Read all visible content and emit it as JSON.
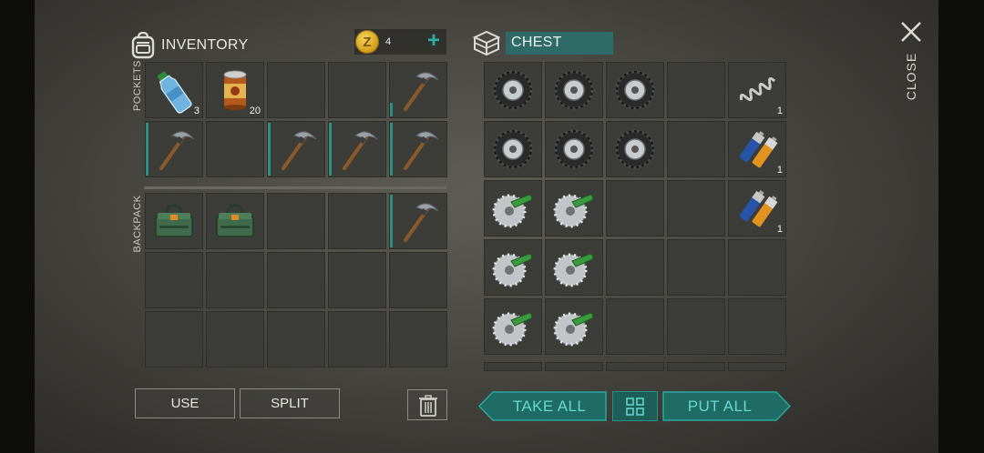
{
  "inventory": {
    "title": "INVENTORY",
    "coins": "4",
    "pockets_label": "POCKETS",
    "backpack_label": "BACKPACK",
    "pockets": [
      {
        "item": "water-bottle",
        "qty": "3"
      },
      {
        "item": "canned-food",
        "qty": "20"
      },
      {
        "item": "empty"
      },
      {
        "item": "empty"
      },
      {
        "item": "pickaxe",
        "durability": 0.25
      },
      {
        "item": "pickaxe",
        "durability": 1.0
      },
      {
        "item": "empty"
      },
      {
        "item": "pickaxe",
        "durability": 1.0
      },
      {
        "item": "pickaxe",
        "durability": 1.0
      },
      {
        "item": "pickaxe",
        "durability": 1.0
      }
    ],
    "backpack": [
      {
        "item": "toolbox"
      },
      {
        "item": "toolbox"
      },
      {
        "item": "empty"
      },
      {
        "item": "empty"
      },
      {
        "item": "pickaxe",
        "durability": 1.0
      },
      {
        "item": "empty"
      },
      {
        "item": "empty"
      },
      {
        "item": "empty"
      },
      {
        "item": "empty"
      },
      {
        "item": "empty"
      },
      {
        "item": "empty"
      },
      {
        "item": "empty"
      },
      {
        "item": "empty"
      },
      {
        "item": "empty"
      },
      {
        "item": "empty"
      }
    ]
  },
  "chest": {
    "title": "CHEST",
    "slots": [
      {
        "item": "tire"
      },
      {
        "item": "tire"
      },
      {
        "item": "tire"
      },
      {
        "item": "empty"
      },
      {
        "item": "spring",
        "qty": "1"
      },
      {
        "item": "tire"
      },
      {
        "item": "tire"
      },
      {
        "item": "tire"
      },
      {
        "item": "empty"
      },
      {
        "item": "batteries",
        "qty": "1"
      },
      {
        "item": "saw-blade"
      },
      {
        "item": "saw-blade"
      },
      {
        "item": "empty"
      },
      {
        "item": "empty"
      },
      {
        "item": "batteries",
        "qty": "1"
      },
      {
        "item": "saw-blade"
      },
      {
        "item": "saw-blade"
      },
      {
        "item": "empty"
      },
      {
        "item": "empty"
      },
      {
        "item": "empty"
      },
      {
        "item": "saw-blade"
      },
      {
        "item": "saw-blade"
      },
      {
        "item": "empty"
      },
      {
        "item": "empty"
      },
      {
        "item": "empty"
      }
    ]
  },
  "buttons": {
    "use": "USE",
    "split": "SPLIT",
    "take_all": "TAKE ALL",
    "put_all": "PUT ALL",
    "close": "CLOSE"
  },
  "colors": {
    "accent_teal": "#2fb2a6",
    "chest_label_bg": "#2e6a66",
    "button_teal": "#1f6b65"
  }
}
